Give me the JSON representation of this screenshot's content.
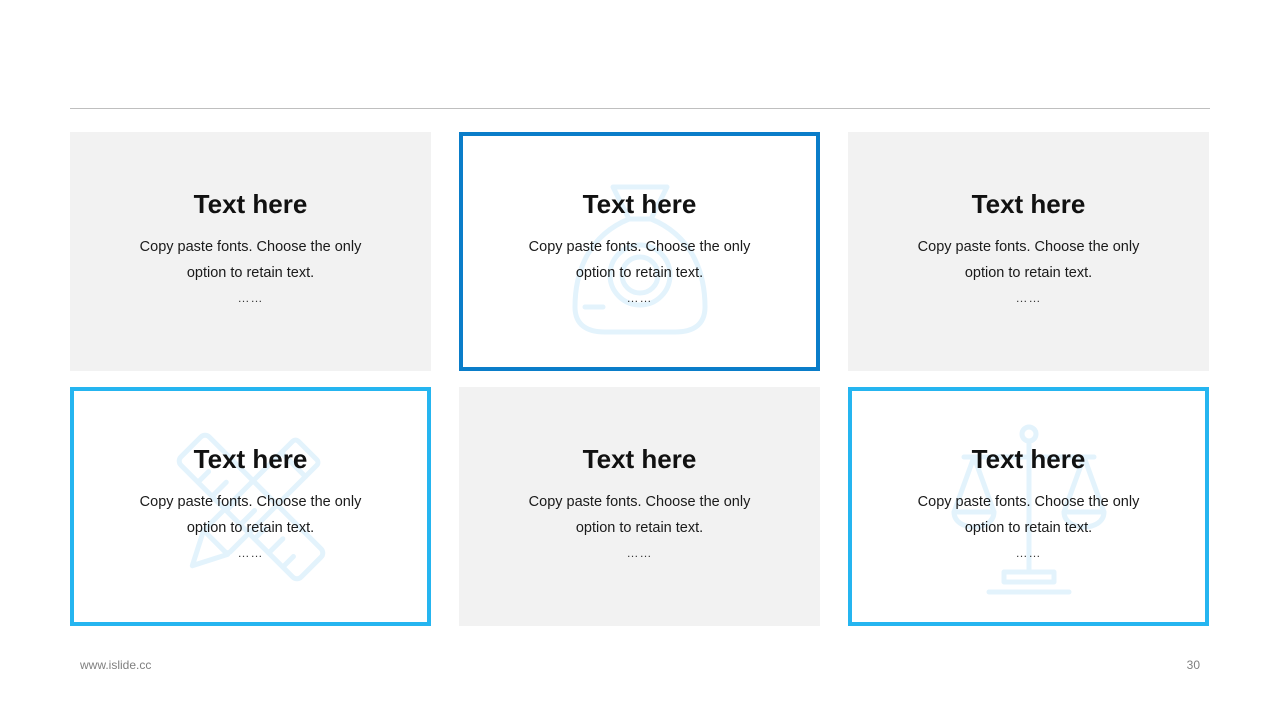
{
  "colors": {
    "card_grey": "#f2f2f2",
    "border_dark_blue": "#0a7dc9",
    "border_light_blue": "#25b5f0",
    "watermark_blue": "#e3f3fc"
  },
  "cards": [
    {
      "title": "Text here",
      "line1": "Copy paste fonts. Choose the only",
      "line2": "option to retain text.",
      "ellipsis": "……",
      "style": "grey",
      "icon": ""
    },
    {
      "title": "Text here",
      "line1": "Copy paste fonts. Choose the only",
      "line2": "option to retain text.",
      "ellipsis": "……",
      "style": "outline-dark",
      "icon": "money-bag-icon"
    },
    {
      "title": "Text here",
      "line1": "Copy paste fonts. Choose the only",
      "line2": "option to retain text.",
      "ellipsis": "……",
      "style": "grey",
      "icon": ""
    },
    {
      "title": "Text here",
      "line1": "Copy paste fonts. Choose the only",
      "line2": "option to retain text.",
      "ellipsis": "……",
      "style": "outline-light",
      "icon": "ruler-pencil-icon"
    },
    {
      "title": "Text here",
      "line1": "Copy paste fonts. Choose the only",
      "line2": "option to retain text.",
      "ellipsis": "……",
      "style": "grey",
      "icon": ""
    },
    {
      "title": "Text here",
      "line1": "Copy paste fonts. Choose the only",
      "line2": "option to retain text.",
      "ellipsis": "……",
      "style": "outline-light",
      "icon": "scales-icon"
    }
  ],
  "footer": {
    "url": "www.islide.cc",
    "page_number": "30"
  }
}
